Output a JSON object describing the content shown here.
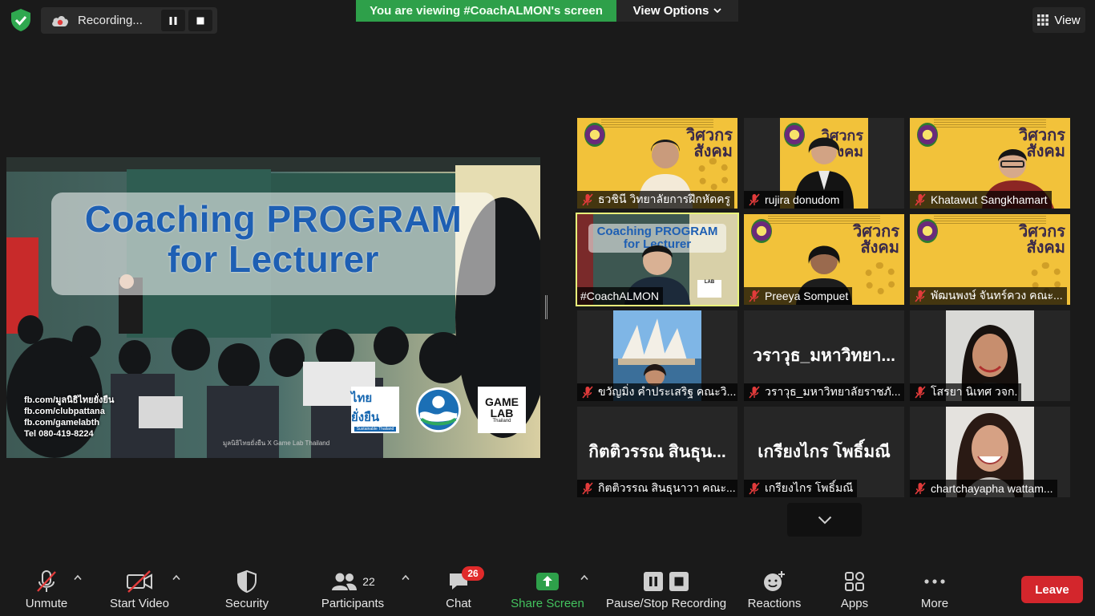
{
  "top": {
    "recording_label": "Recording...",
    "viewing_banner": "You are viewing #CoachALMON's screen",
    "view_options_label": "View Options",
    "view_label": "View"
  },
  "slide": {
    "title_line1": "Coaching PROGRAM",
    "title_line2": "for Lecturer",
    "links": [
      "fb.com/มูลนิธิไทยยั่งยืน",
      "fb.com/clubpattana",
      "fb.com/gamelabth",
      "Tel 080-419-8224"
    ],
    "footer": "มูลนิธิไทยยั่งยืน X Game Lab Thailand",
    "logo1_title": "ไทยยั่งยืน",
    "logo1_sub": "Sustainable Thailand",
    "logo3_title": "GAME LAB",
    "logo3_sub": "Thailand"
  },
  "tiles": [
    {
      "name": "ธวชินี  วิทยาลัยการฝึกหัดครู",
      "kind": "yellow"
    },
    {
      "name": "rujira donudom",
      "kind": "yellow"
    },
    {
      "name": "Khatawut Sangkhamart",
      "kind": "yellow"
    },
    {
      "name": "#CoachALMON",
      "kind": "active",
      "overlay_title1": "Coaching PROGRAM",
      "overlay_title2": "for Lecturer"
    },
    {
      "name": "Preeya Sompuet",
      "kind": "yellow"
    },
    {
      "name": "พัฒนพงษ์ จันทร์ควง คณะ...",
      "kind": "yellow"
    },
    {
      "name": "ขวัญมิ่ง คำประเสริฐ คณะวิ...",
      "kind": "photo"
    },
    {
      "name": "วราวุธ_มหาวิทยาลัยราชภั...",
      "kind": "text",
      "big": "วราวุธ_มหาวิทยา..."
    },
    {
      "name": "โสรยา นิเทศ วจก.",
      "kind": "face"
    },
    {
      "name": "กิตติวรรณ สินธุนาวา คณะ...",
      "kind": "text",
      "big": "กิตติวรรณ สินธุน..."
    },
    {
      "name": "เกรียงไกร โพธิ์มณี",
      "kind": "text",
      "big": "เกรียงไกร โพธิ์มณี"
    },
    {
      "name": "chartchayapha wattam...",
      "kind": "face"
    }
  ],
  "yellow_backdrop": {
    "line1": "วิศวกร",
    "line2": "สังคม"
  },
  "toolbar": {
    "unmute": "Unmute",
    "start_video": "Start Video",
    "security": "Security",
    "participants": "Participants",
    "participants_count": "22",
    "chat": "Chat",
    "chat_badge": "26",
    "share_screen": "Share Screen",
    "pause_stop_recording": "Pause/Stop Recording",
    "reactions": "Reactions",
    "apps": "Apps",
    "more": "More",
    "leave": "Leave"
  },
  "colors": {
    "share_green": "#2ea04a",
    "leave_red": "#d3262c",
    "active_outline": "#e9f57a",
    "tile_yellow": "#f2c23a"
  }
}
